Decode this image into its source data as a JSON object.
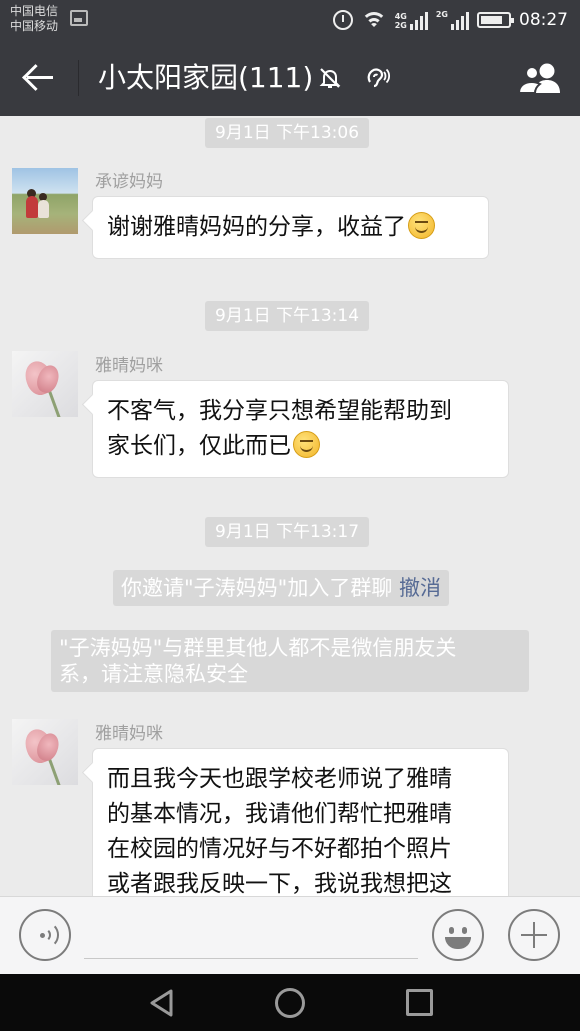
{
  "status_bar": {
    "carrier_1": "中国电信",
    "carrier_2": "中国移动",
    "network_1": "4G",
    "network_2": "2G",
    "network_3": "2G",
    "time": "08:27"
  },
  "header": {
    "title": "小太阳家园(111)",
    "icons": [
      "back-arrow-icon",
      "mute-icon",
      "earpiece-icon",
      "group-members-icon"
    ]
  },
  "messages": [
    {
      "type": "timestamp",
      "text": "9月1日 下午13:06"
    },
    {
      "type": "message",
      "sender": "承谚妈妈",
      "avatar": "child-photo",
      "text": "谢谢雅晴妈妈的分享，收益了",
      "emoji": "smile"
    },
    {
      "type": "timestamp",
      "text": "9月1日 下午13:14"
    },
    {
      "type": "message",
      "sender": "雅晴妈咪",
      "avatar": "tulip",
      "lines": [
        "不客气，我分享只想希望能帮助到",
        "家长们，仅此而已"
      ],
      "emoji": "smile"
    },
    {
      "type": "timestamp",
      "text": "9月1日 下午13:17"
    },
    {
      "type": "system",
      "text": "你邀请\"子涛妈妈\"加入了群聊",
      "link": "撤消"
    },
    {
      "type": "system",
      "lines": [
        "\"子涛妈妈\"与群里其他人都不是微信朋友关",
        "系，请注意隐私安全"
      ]
    },
    {
      "type": "message",
      "sender": "雅晴妈咪",
      "avatar": "tulip",
      "lines": [
        "而且我今天也跟学校老师说了雅晴",
        "的基本情况，我请他们帮忙把雅晴",
        "在校园的情况好与不好都拍个照片",
        "或者跟我反映一下，我说我想把这"
      ]
    }
  ],
  "input_bar": {
    "icons": [
      "voice-icon",
      "emoji-icon",
      "plus-icon"
    ],
    "value": ""
  },
  "colors": {
    "header_bg": "#393a3f",
    "chat_bg": "#ebebeb",
    "link": "#576b95",
    "timestamp_bg": "#d8d8d8"
  }
}
